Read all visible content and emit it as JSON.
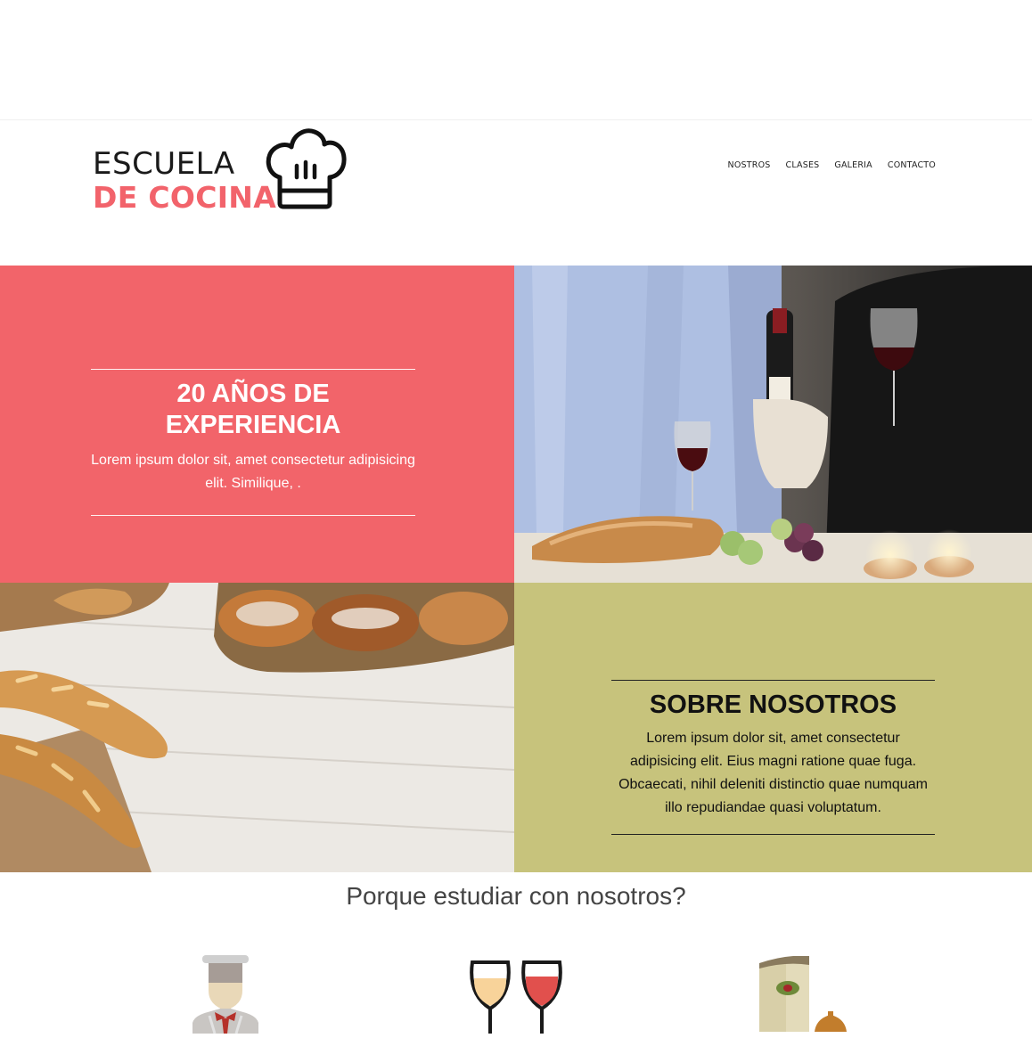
{
  "brand": {
    "line1": "ESCUELA",
    "line2": "DE COCINA",
    "accent": "#f2636b",
    "icon": "chef-hat-icon"
  },
  "nav": {
    "items": [
      "NOSTROS",
      "CLASES",
      "GALERIA",
      "CONTACTO"
    ]
  },
  "hero": {
    "title": "20 AÑOS DE EXPERIENCIA",
    "text": "Lorem ipsum dolor sit, amet consectetur adipisicing elit. Similique, .",
    "background": "#f2646a"
  },
  "about": {
    "title": "SOBRE NOSOTROS",
    "text": "Lorem ipsum dolor sit, amet consectetur adipisicing elit. Eius magni ratione quae fuga. Obcaecati, nihil deleniti distinctio quae numquam illo repudiandae quasi voluptatum.",
    "background": "#c7c37c"
  },
  "images": {
    "wine": "wine-dinner-photo",
    "bread": "bread-table-photo"
  },
  "why": {
    "title": "Porque estudiar con nosotros?",
    "icons": [
      "chef-icon",
      "wine-glasses-icon",
      "menu-icon"
    ]
  }
}
